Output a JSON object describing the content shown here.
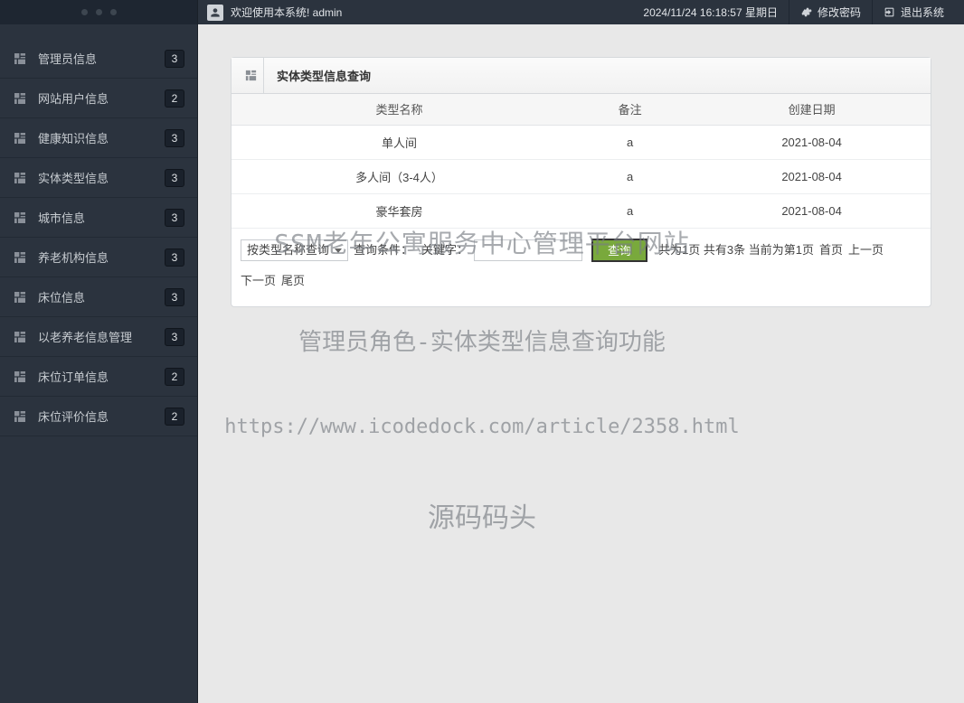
{
  "header": {
    "welcome": "欢迎使用本系统! admin",
    "datetime": "2024/11/24 16:18:57 星期日",
    "change_pwd": "修改密码",
    "logout": "退出系统"
  },
  "sidebar": {
    "items": [
      {
        "label": "管理员信息",
        "badge": "3"
      },
      {
        "label": "网站用户信息",
        "badge": "2"
      },
      {
        "label": "健康知识信息",
        "badge": "3"
      },
      {
        "label": "实体类型信息",
        "badge": "3"
      },
      {
        "label": "城市信息",
        "badge": "3"
      },
      {
        "label": "养老机构信息",
        "badge": "3"
      },
      {
        "label": "床位信息",
        "badge": "3"
      },
      {
        "label": "以老养老信息管理",
        "badge": "3"
      },
      {
        "label": "床位订单信息",
        "badge": "2"
      },
      {
        "label": "床位评价信息",
        "badge": "2"
      }
    ]
  },
  "panel": {
    "title": "实体类型信息查询",
    "columns": [
      "类型名称",
      "备注",
      "创建日期"
    ],
    "rows": [
      {
        "name": "单人间",
        "remark": "a",
        "date": "2021-08-04"
      },
      {
        "name": "多人间（3-4人）",
        "remark": "a",
        "date": "2021-08-04"
      },
      {
        "name": "豪华套房",
        "remark": "a",
        "date": "2021-08-04"
      }
    ],
    "footer": {
      "select_option": "按类型名称查询",
      "cond_label": "查询条件：",
      "kw_label": "关键字：",
      "kw_value": "",
      "search_btn": "查询",
      "pager_summary": "共为1页 共有3条 当前为第1页",
      "first": "首页",
      "prev": "上一页",
      "next": "下一页",
      "last": "尾页"
    }
  },
  "watermarks": {
    "line1": "SSM老年公寓服务中心管理平台网站",
    "line2": "管理员角色-实体类型信息查询功能",
    "line3": "https://www.icodedock.com/article/2358.html",
    "line4": "源码码头"
  }
}
